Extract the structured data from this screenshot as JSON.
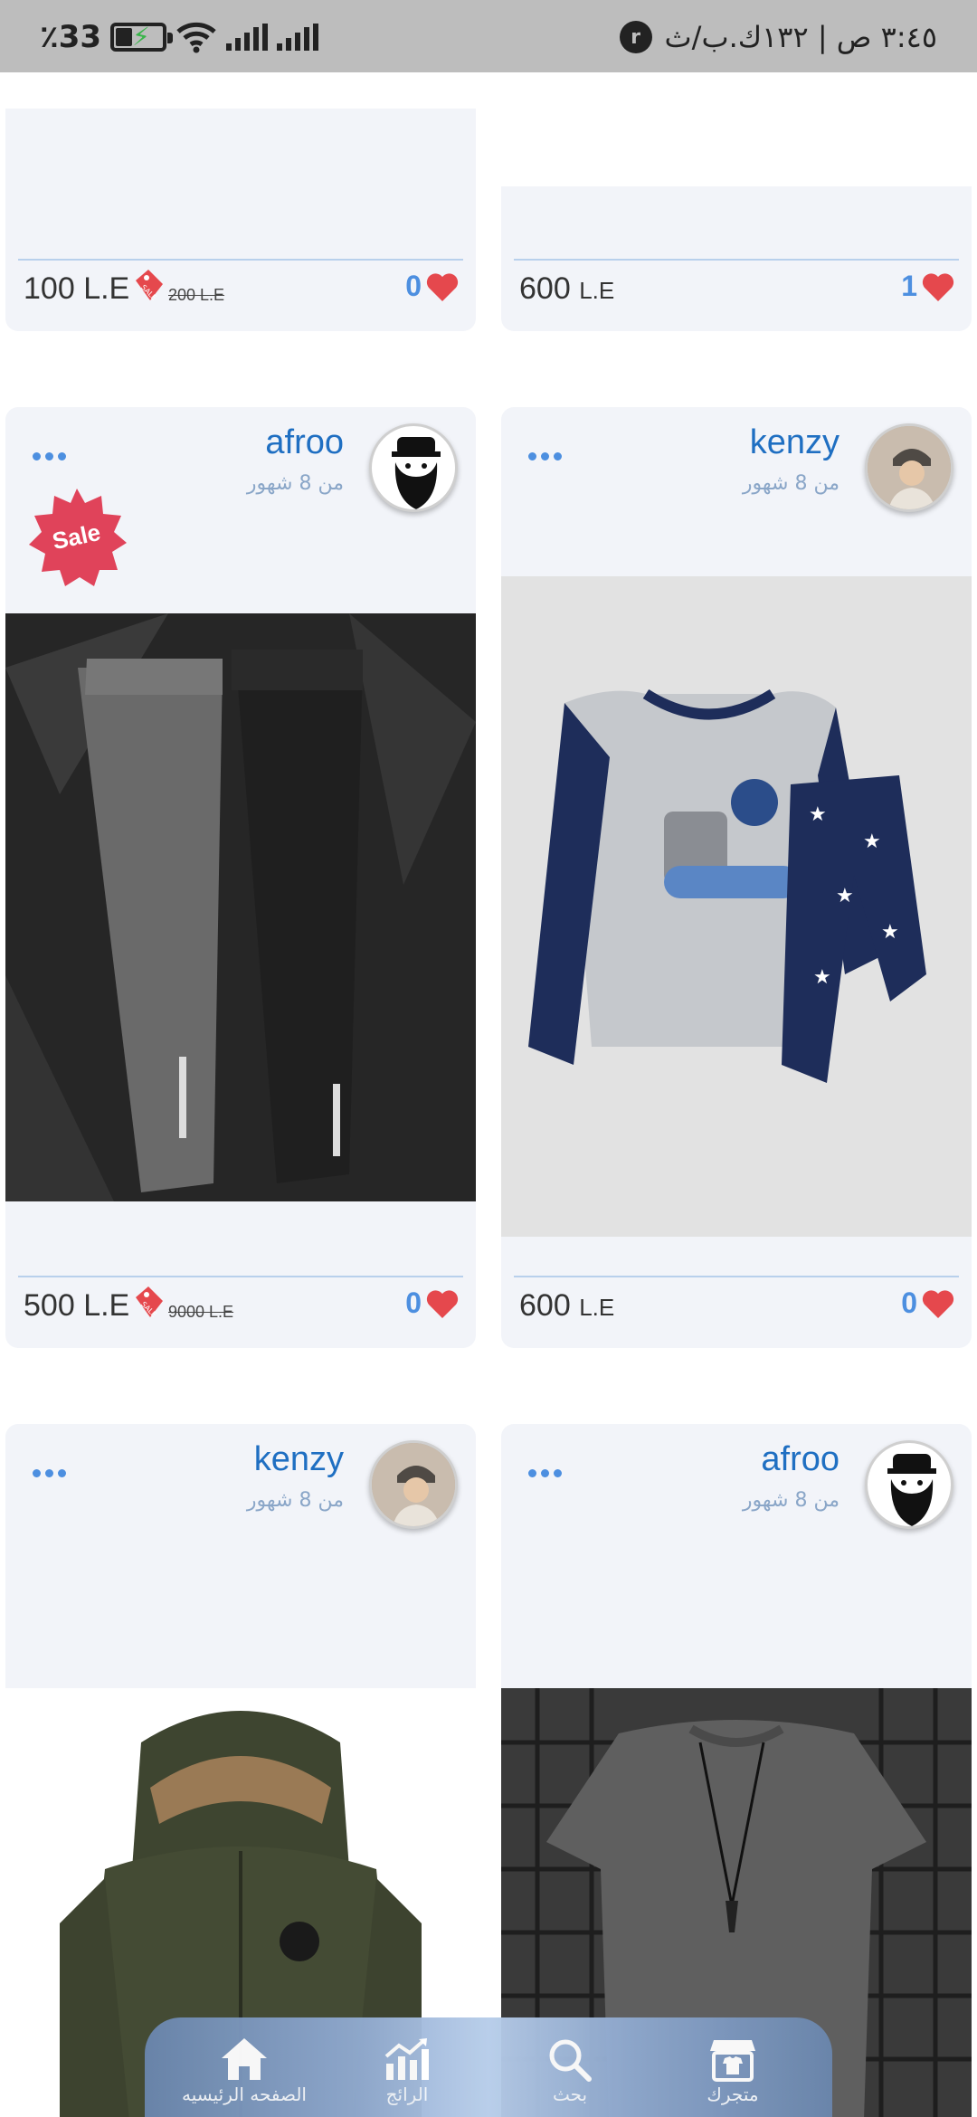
{
  "status_bar": {
    "battery": "33",
    "percent_sign": "٪",
    "time": "٣:٤٥ ص | ١٣٢ك.ب/ث"
  },
  "colors": {
    "accent": "#4d8fe0",
    "seller_name": "#1f6fc2",
    "heart": "#e5484d",
    "card_bg": "#f2f4f9"
  },
  "cards": [
    {
      "price": "100",
      "currency": "L.E",
      "old_price": "200 L.E",
      "likes": "0",
      "on_sale": true
    },
    {
      "price": "600",
      "currency": "L.E",
      "likes": "1",
      "on_sale": false
    },
    {
      "seller": "afroo",
      "time_ago": "من 8 شهور",
      "price": "500",
      "currency": "L.E",
      "old_price": "9000 L.E",
      "likes": "0",
      "on_sale": true,
      "badge": "Sale"
    },
    {
      "seller": "kenzy",
      "time_ago": "من 8 شهور",
      "price": "600",
      "currency": "L.E",
      "likes": "0",
      "on_sale": false
    },
    {
      "seller": "kenzy",
      "time_ago": "من 8 شهور"
    },
    {
      "seller": "afroo",
      "time_ago": "من 8 شهور"
    }
  ],
  "nav": {
    "home": "الصفحه الرئيسيه",
    "trending": "الرائج",
    "search": "بحث",
    "store": "متجرك"
  },
  "icons": {
    "home": "home-icon",
    "trending": "chart-icon",
    "search": "search-icon",
    "store": "store-icon"
  }
}
